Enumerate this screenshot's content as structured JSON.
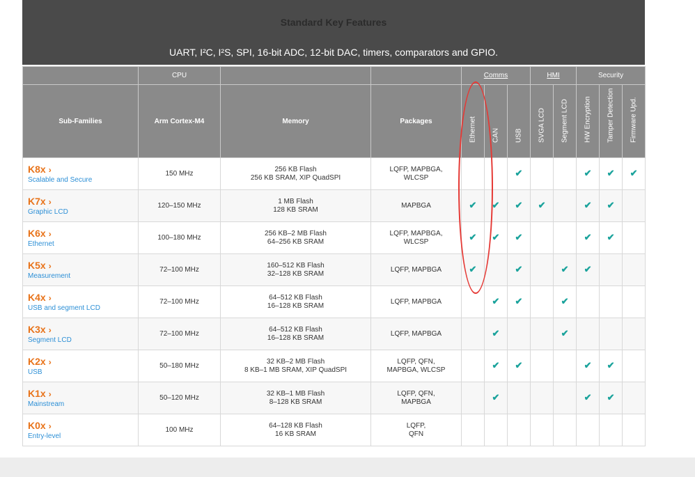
{
  "banner": {
    "title": "Standard Key Features",
    "subtitle": "UART, I²C, I²S, SPI, 16-bit ADC, 12-bit DAC, timers, comparators and GPIO."
  },
  "groups": {
    "cpu": "CPU",
    "comms": "Comms",
    "hmi": "HMI",
    "security": "Security"
  },
  "columns": {
    "subfamilies": "Sub-Families",
    "cpu_core": "Arm Cortex-M4",
    "memory": "Memory",
    "packages": "Packages",
    "features": [
      "Ethernet",
      "CAN",
      "USB",
      "SVGA LCD",
      "Segment LCD",
      "HW Encryption",
      "Tamper Detection",
      "Firmware Upd."
    ]
  },
  "check_icon": "check-icon",
  "chevron_icon": "chevron-right-icon",
  "colors": {
    "accent": "#e8731a",
    "link": "#2c8fd6",
    "check": "#1ba39c",
    "highlight": "#e53935"
  },
  "rows": [
    {
      "name": "K8x",
      "desc": "Scalable and Secure",
      "cpu": "150 MHz",
      "mem1": "256 KB Flash",
      "mem2": "256 KB SRAM, XIP QuadSPI",
      "pkg1": "LQFP, MAPBGA,",
      "pkg2": "WLCSP",
      "features": [
        false,
        false,
        true,
        false,
        false,
        true,
        true,
        true
      ]
    },
    {
      "name": "K7x",
      "desc": "Graphic LCD",
      "cpu": "120–150 MHz",
      "mem1": "1 MB Flash",
      "mem2": "128 KB SRAM",
      "pkg1": "MAPBGA",
      "pkg2": "",
      "features": [
        true,
        true,
        true,
        true,
        false,
        true,
        true,
        false
      ]
    },
    {
      "name": "K6x",
      "desc": "Ethernet",
      "cpu": "100–180 MHz",
      "mem1": "256 KB–2 MB Flash",
      "mem2": "64–256 KB SRAM",
      "pkg1": "LQFP, MAPBGA,",
      "pkg2": "WLCSP",
      "features": [
        true,
        true,
        true,
        false,
        false,
        true,
        true,
        false
      ]
    },
    {
      "name": "K5x",
      "desc": "Measurement",
      "cpu": "72–100 MHz",
      "mem1": "160–512 KB Flash",
      "mem2": "32–128 KB SRAM",
      "pkg1": "LQFP, MAPBGA",
      "pkg2": "",
      "features": [
        true,
        false,
        true,
        false,
        true,
        true,
        false,
        false
      ]
    },
    {
      "name": "K4x",
      "desc": "USB and segment LCD",
      "cpu": "72–100 MHz",
      "mem1": "64–512 KB Flash",
      "mem2": "16–128 KB SRAM",
      "pkg1": "LQFP, MAPBGA",
      "pkg2": "",
      "features": [
        false,
        true,
        true,
        false,
        true,
        false,
        false,
        false
      ]
    },
    {
      "name": "K3x",
      "desc": "Segment LCD",
      "cpu": "72–100 MHz",
      "mem1": "64–512 KB Flash",
      "mem2": "16–128 KB SRAM",
      "pkg1": "LQFP, MAPBGA",
      "pkg2": "",
      "features": [
        false,
        true,
        false,
        false,
        true,
        false,
        false,
        false
      ]
    },
    {
      "name": "K2x",
      "desc": "USB",
      "cpu": "50–180 MHz",
      "mem1": "32 KB–2 MB Flash",
      "mem2": "8 KB–1 MB SRAM, XIP QuadSPI",
      "pkg1": "LQFP, QFN,",
      "pkg2": "MAPBGA, WLCSP",
      "features": [
        false,
        true,
        true,
        false,
        false,
        true,
        true,
        false
      ]
    },
    {
      "name": "K1x",
      "desc": "Mainstream",
      "cpu": "50–120 MHz",
      "mem1": "32 KB–1 MB Flash",
      "mem2": "8–128 KB SRAM",
      "pkg1": "LQFP, QFN,",
      "pkg2": "MAPBGA",
      "features": [
        false,
        true,
        false,
        false,
        false,
        true,
        true,
        false
      ]
    },
    {
      "name": "K0x",
      "desc": "Entry-level",
      "cpu": "100 MHz",
      "mem1": "64–128 KB Flash",
      "mem2": "16 KB SRAM",
      "pkg1": "LQFP,",
      "pkg2": "QFN",
      "features": [
        false,
        false,
        false,
        false,
        false,
        false,
        false,
        false
      ]
    }
  ]
}
